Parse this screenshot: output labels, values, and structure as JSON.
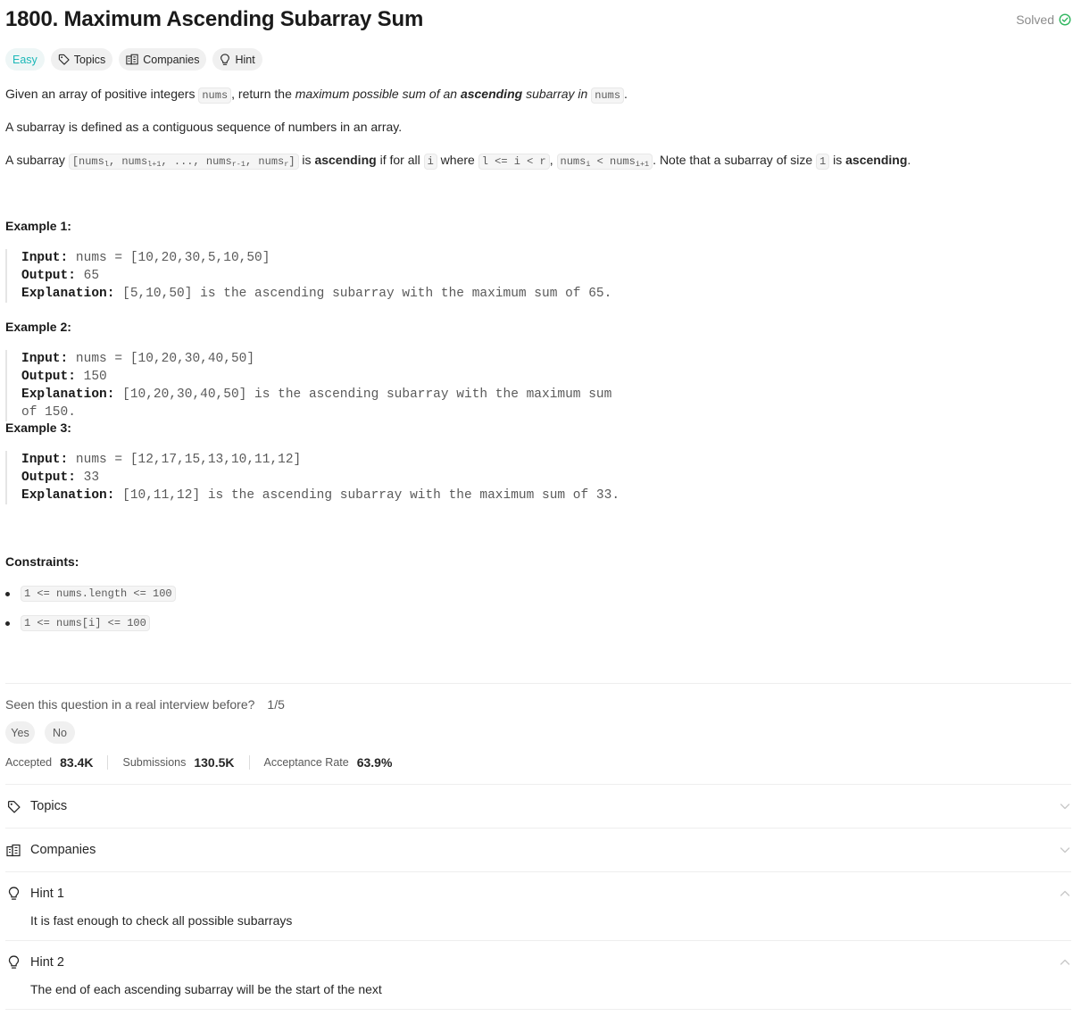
{
  "problem": {
    "title": "1800. Maximum Ascending Subarray Sum",
    "status": "Solved",
    "difficulty": "Easy",
    "tag_topics": "Topics",
    "tag_companies": "Companies",
    "tag_hint": "Hint"
  },
  "description": {
    "p1": {
      "t1": "Given an array of positive integers ",
      "c1": "nums",
      "t2": ", return the ",
      "i1": "maximum possible sum of an ",
      "b1": "ascending",
      "i2": " subarray in ",
      "c2": "nums",
      "t3": "."
    },
    "p2": "A subarray is defined as a contiguous sequence of numbers in an array.",
    "p3": {
      "t1": "A subarray ",
      "c1_a": "[nums",
      "c1_sub1": "l",
      "c1_b": ", nums",
      "c1_sub2": "l+1",
      "c1_c": ", ..., nums",
      "c1_sub3": "r-1",
      "c1_d": ", nums",
      "c1_sub4": "r",
      "c1_e": "]",
      "t2": " is ",
      "b1": "ascending",
      "t3": " if for all ",
      "c2": "i",
      "t4": " where ",
      "c3": "l <= i < r",
      "t5": ", ",
      "c4_a": "nums",
      "c4_sub1": "i",
      "c4_b": " < nums",
      "c4_sub2": "i+1",
      "t6": ". Note that a subarray of size ",
      "c5": "1",
      "t7": " is ",
      "b2": "ascending",
      "t8": "."
    }
  },
  "examples": [
    {
      "title": "Example 1:",
      "input_label": "Input:",
      "input": "nums = [10,20,30,5,10,50]",
      "output_label": "Output:",
      "output": "65",
      "explanation_label": "Explanation:",
      "explanation": "[5,10,50] is the ascending subarray with the maximum sum of 65."
    },
    {
      "title": "Example 2:",
      "input_label": "Input:",
      "input": "nums = [10,20,30,40,50]",
      "output_label": "Output:",
      "output": "150",
      "explanation_label": "Explanation:",
      "explanation": "[10,20,30,40,50] is the ascending subarray with the maximum sum of 150."
    },
    {
      "title": "Example 3:",
      "input_label": "Input:",
      "input": "nums = [12,17,15,13,10,11,12]",
      "output_label": "Output:",
      "output": "33",
      "explanation_label": "Explanation:",
      "explanation": "[10,11,12] is the ascending subarray with the maximum sum of 33."
    }
  ],
  "constraints": {
    "title": "Constraints:",
    "items": [
      "1 <= nums.length <= 100",
      "1 <= nums[i] <= 100"
    ]
  },
  "interview": {
    "question": "Seen this question in a real interview before?",
    "fraction": "1/5",
    "yes": "Yes",
    "no": "No"
  },
  "stats": {
    "accepted_label": "Accepted",
    "accepted": "83.4K",
    "submissions_label": "Submissions",
    "submissions": "130.5K",
    "rate_label": "Acceptance Rate",
    "rate": "63.9%"
  },
  "sections": {
    "topics": "Topics",
    "companies": "Companies",
    "hint1_title": "Hint 1",
    "hint1_body": "It is fast enough to check all possible subarrays",
    "hint2_title": "Hint 2",
    "hint2_body": "The end of each ascending subarray will be the start of the next"
  },
  "colors": {
    "easy": "#1cb8b8",
    "solved_check": "#2db55d",
    "text": "#262626",
    "muted": "#8c8c8c"
  }
}
